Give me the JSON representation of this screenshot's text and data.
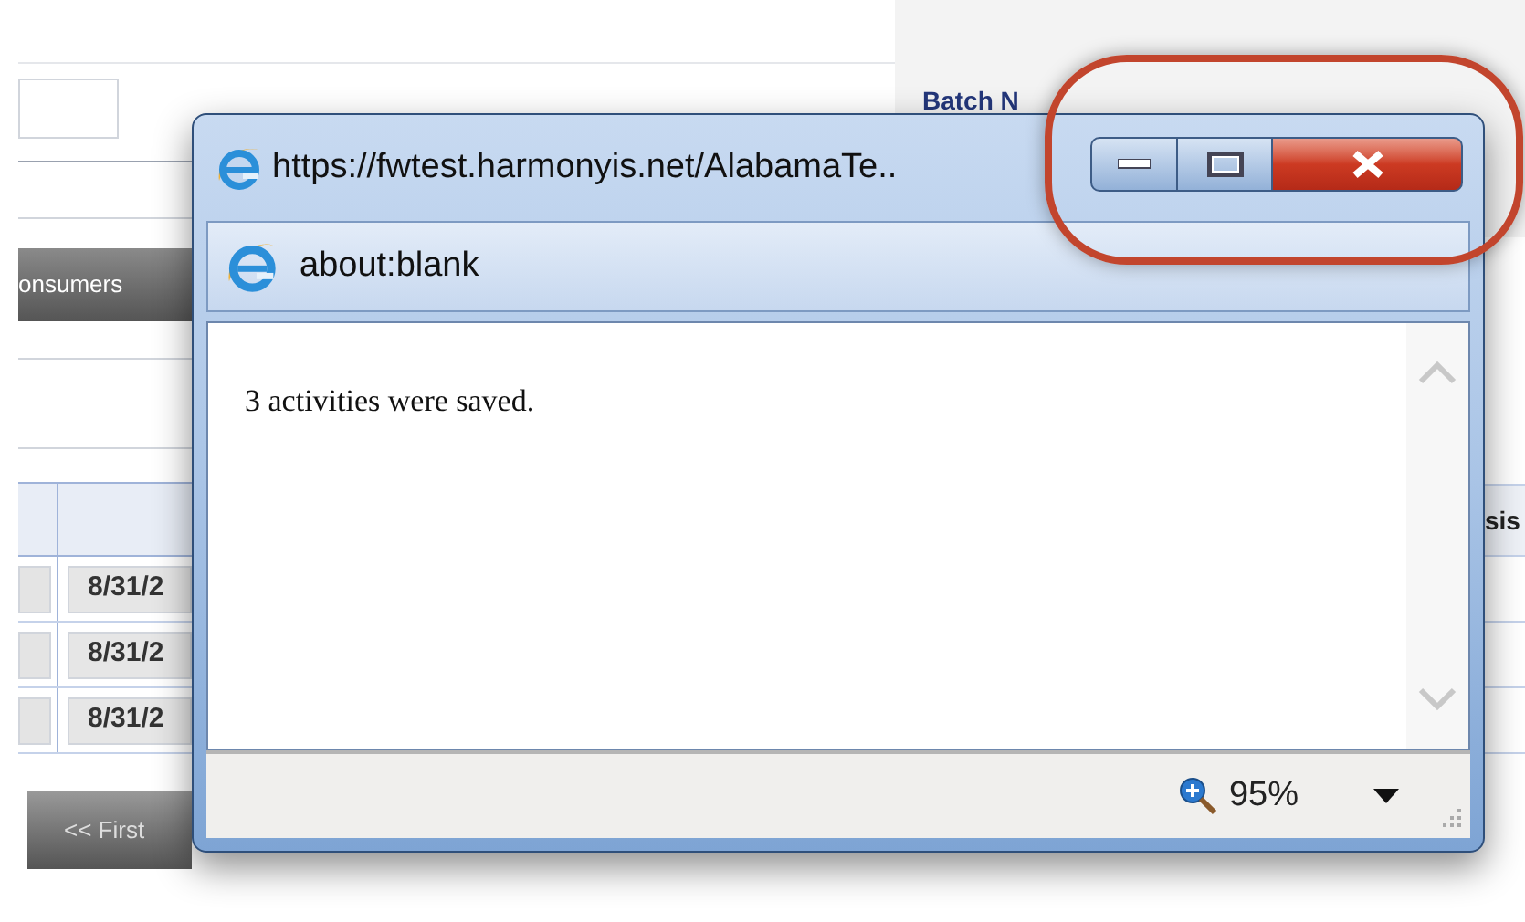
{
  "background_page": {
    "batch_label": "Batch N",
    "tab": "onsumers",
    "column_header": "sis",
    "rows": [
      {
        "date": "8/31/2"
      },
      {
        "date": "8/31/2"
      },
      {
        "date": "8/31/2"
      }
    ],
    "first_button": "<< First"
  },
  "popup": {
    "title": "https://fwtest.harmonyis.net/AlabamaTe..",
    "address": "about:blank",
    "message": "3 activities were saved.",
    "zoom": "95%"
  }
}
